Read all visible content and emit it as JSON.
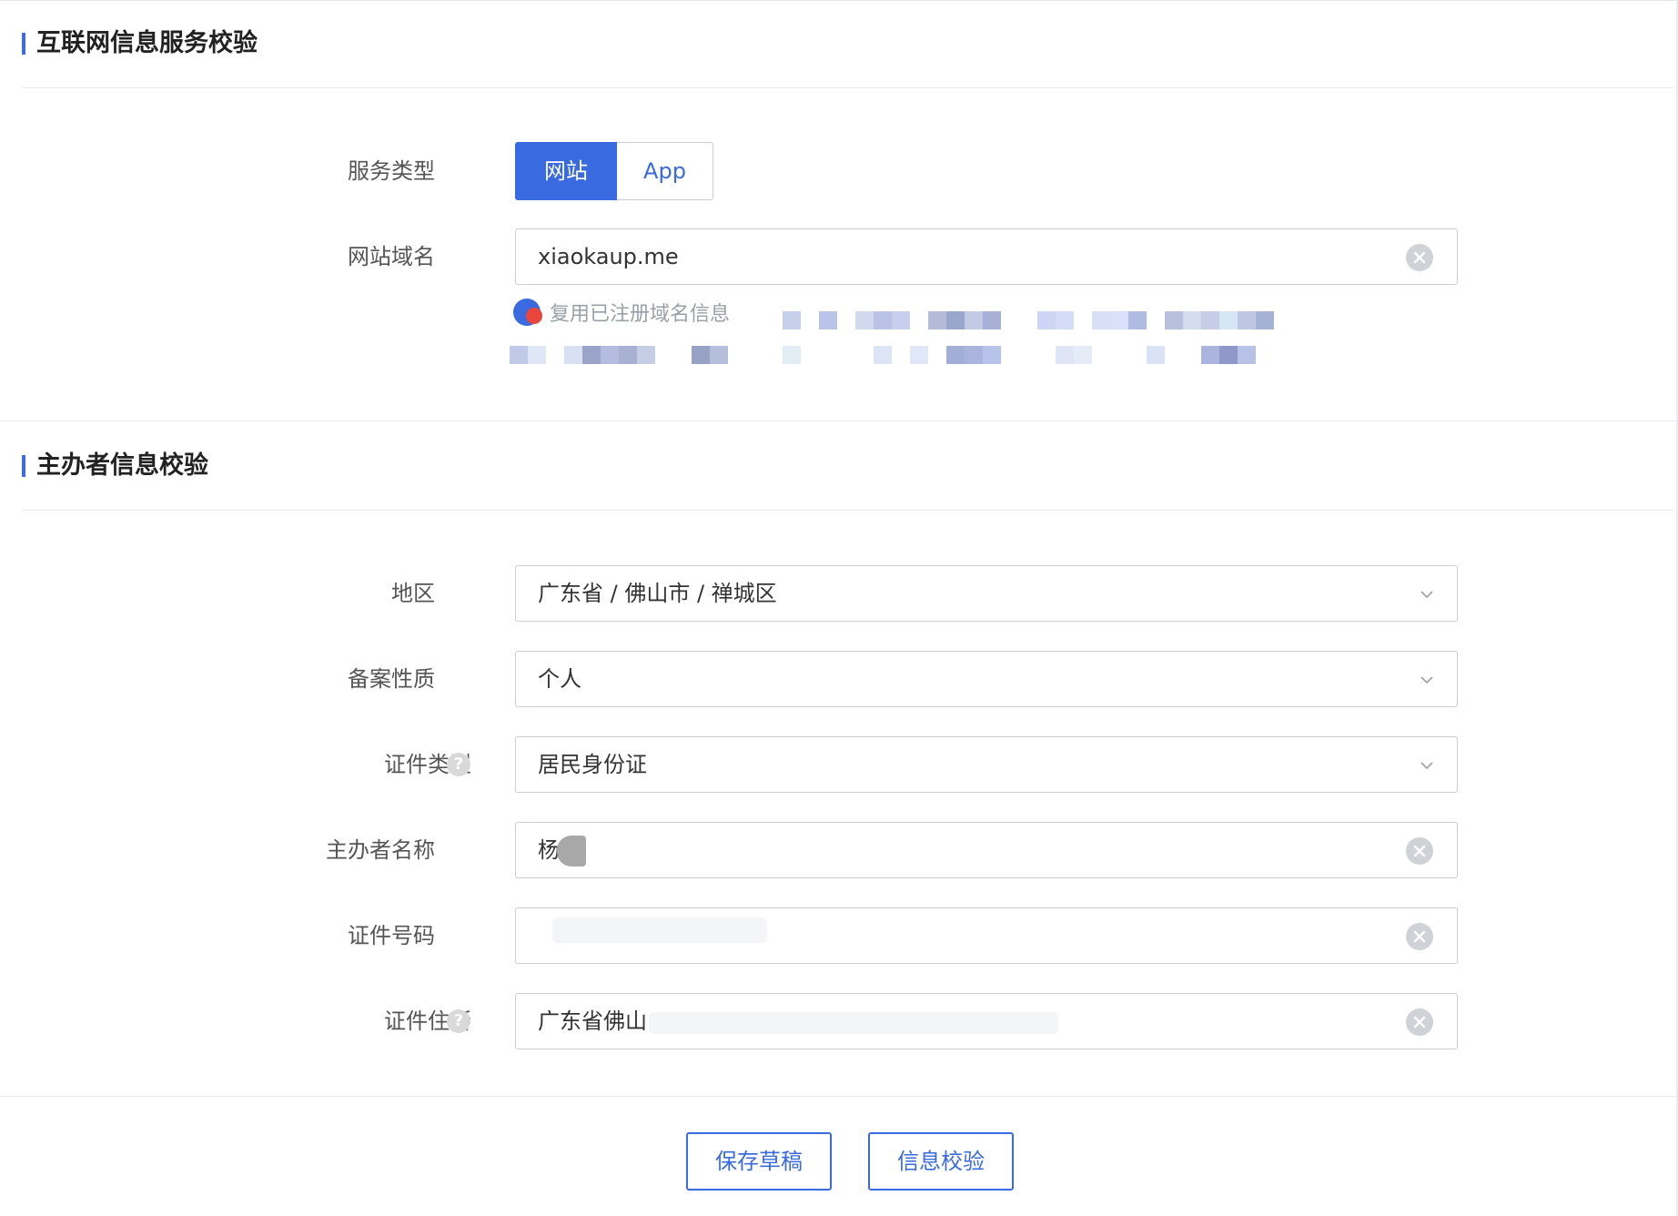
{
  "section1": {
    "title": "互联网信息服务校验"
  },
  "service_type": {
    "label": "服务类型",
    "options": [
      "网站",
      "App"
    ],
    "selected": "网站"
  },
  "domain": {
    "label": "网站域名",
    "value": "xiaokaup.me"
  },
  "reuse": {
    "text": "复用已注册域名信息"
  },
  "section2": {
    "title": "主办者信息校验"
  },
  "region": {
    "label": "地区",
    "value": "广东省 / 佛山市 / 禅城区"
  },
  "record_nature": {
    "label": "备案性质",
    "value": "个人"
  },
  "cert_type": {
    "label": "证件类型",
    "value": "居民身份证"
  },
  "sponsor_name": {
    "label": "主办者名称",
    "value": "杨"
  },
  "cert_number": {
    "label": "证件号码",
    "value": ""
  },
  "cert_address": {
    "label": "证件住所",
    "value": "广东省佛山"
  },
  "actions": {
    "save_draft": "保存草稿",
    "verify": "信息校验"
  },
  "colors": {
    "accent": "#3a6ae0",
    "border": "#c9cdd4",
    "label_text": "#555555"
  }
}
